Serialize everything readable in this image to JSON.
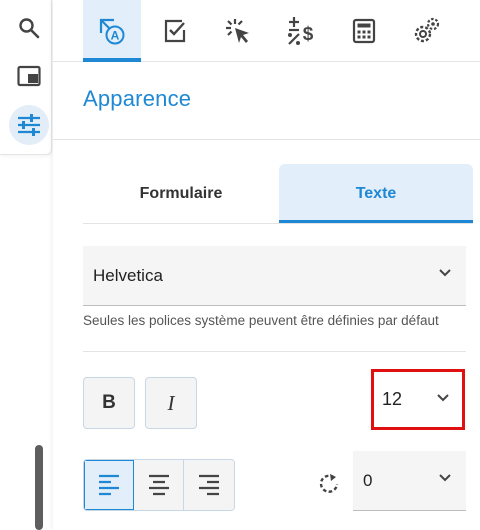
{
  "colors": {
    "accent": "#1e88d4",
    "active_bg": "#e2eef9",
    "highlight": "#e01010"
  },
  "rail": {
    "items": [
      {
        "icon": "search-icon"
      },
      {
        "icon": "panel-icon"
      },
      {
        "icon": "sliders-icon",
        "active": true
      }
    ]
  },
  "toolbar": {
    "tabs": [
      {
        "icon": "text-annotation-icon",
        "active": true
      },
      {
        "icon": "checkbox-icon"
      },
      {
        "icon": "cursor-click-icon"
      },
      {
        "icon": "calculation-icon"
      },
      {
        "icon": "calculator-icon"
      },
      {
        "icon": "settings-gears-icon"
      }
    ]
  },
  "section": {
    "title": "Apparence"
  },
  "subtabs": [
    {
      "label": "Formulaire",
      "active": false
    },
    {
      "label": "Texte",
      "active": true
    }
  ],
  "font": {
    "value": "Helvetica",
    "helper": "Seules les polices système peuvent être définies par défaut"
  },
  "text_style": {
    "bold_label": "B",
    "italic_label": "I"
  },
  "font_size": {
    "value": "12"
  },
  "alignment": {
    "selected": "left",
    "options": [
      "left",
      "center",
      "right"
    ]
  },
  "rotation": {
    "value": "0"
  }
}
